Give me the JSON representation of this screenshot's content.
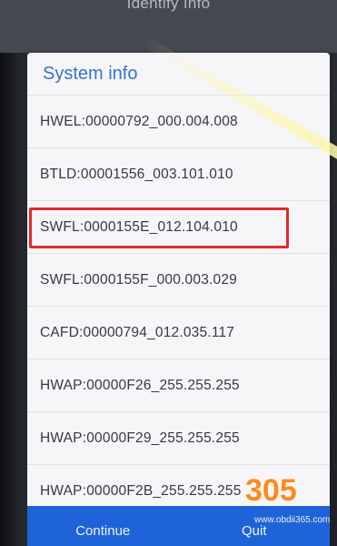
{
  "topbar": {
    "title": "Identify Info"
  },
  "dialog": {
    "title": "System info",
    "rows": [
      "HWEL:00000792_000.004.008",
      "BTLD:00001556_003.101.010",
      "SWFL:0000155E_012.104.010",
      "SWFL:0000155F_000.003.029",
      "CAFD:00000794_012.035.117",
      "HWAP:00000F26_255.255.255",
      "HWAP:00000F29_255.255.255",
      "HWAP:00000F2B_255.255.255"
    ],
    "highlighted_row_index": 2,
    "highlight_color": "#e02a2a",
    "accent_color": "#1f63d8"
  },
  "footer": {
    "continue_label": "Continue",
    "quit_label": "Quit"
  },
  "watermark": {
    "logo": "305",
    "url": "www.obdii365.com"
  }
}
